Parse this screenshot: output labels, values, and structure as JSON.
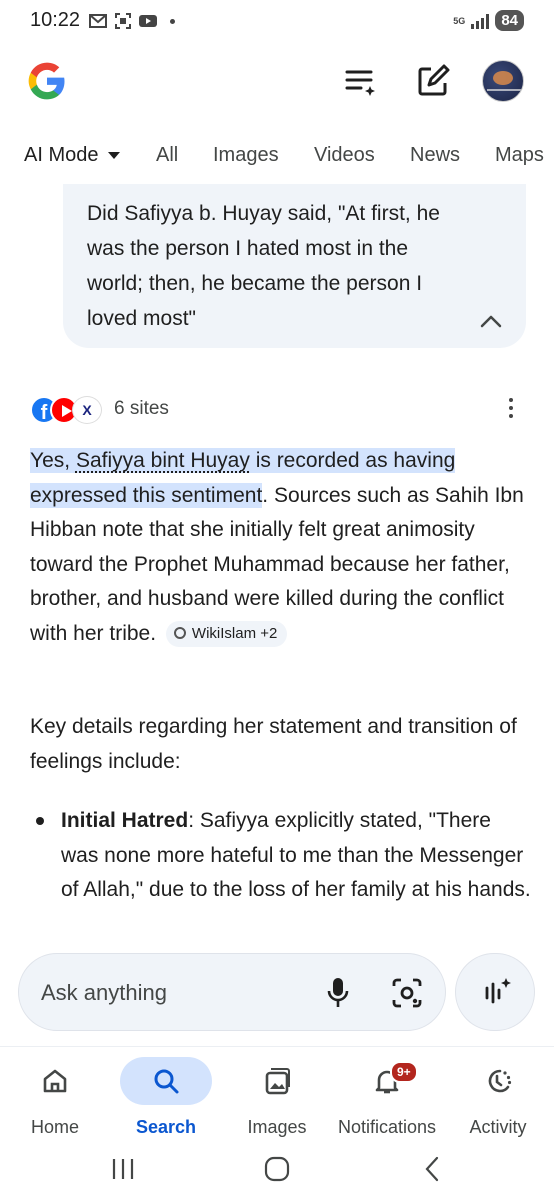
{
  "status": {
    "time": "10:22",
    "network": "5G",
    "battery": "84"
  },
  "tabs": [
    {
      "label": "AI Mode"
    },
    {
      "label": "All"
    },
    {
      "label": "Images"
    },
    {
      "label": "Videos"
    },
    {
      "label": "News"
    },
    {
      "label": "Maps"
    }
  ],
  "query": {
    "text": "Did Safiyya b. Huyay said, \"At first, he was the person I hated most in the world; then, he became the person I loved most\""
  },
  "sources": {
    "count_label": "6 sites",
    "icons": [
      "facebook-icon",
      "youtube-icon",
      "x-tv-icon"
    ]
  },
  "answer": {
    "highlight_1": "Yes, ",
    "highlight_name": "Safiyya bint Huyay",
    "highlight_2": " is recorded as having expressed this sentiment",
    "body": ". Sources such as Sahih Ibn Hibban note that she initially felt great animosity toward the Prophet Muhammad because her father, brother, and husband were killed during the conflict with her tribe.",
    "citation": "WikiIslam +2"
  },
  "para2": "Key details regarding her statement and transition of feelings include:",
  "bullet": {
    "title": "Initial Hatred",
    "text": ": Safiyya explicitly stated, \"There was none more hateful to me than the Messenger of Allah,\" due to the loss of her family at his hands."
  },
  "ask": {
    "placeholder": "Ask anything"
  },
  "nav": [
    {
      "label": "Home",
      "active": false
    },
    {
      "label": "Search",
      "active": true
    },
    {
      "label": "Images",
      "active": false
    },
    {
      "label": "Notifications",
      "active": false,
      "badge": "9+"
    },
    {
      "label": "Activity",
      "active": false
    }
  ],
  "colors": {
    "accent": "#0b57d0",
    "highlight": "#d3e3fd",
    "surface": "#f0f4f9",
    "badge": "#b3261e"
  }
}
